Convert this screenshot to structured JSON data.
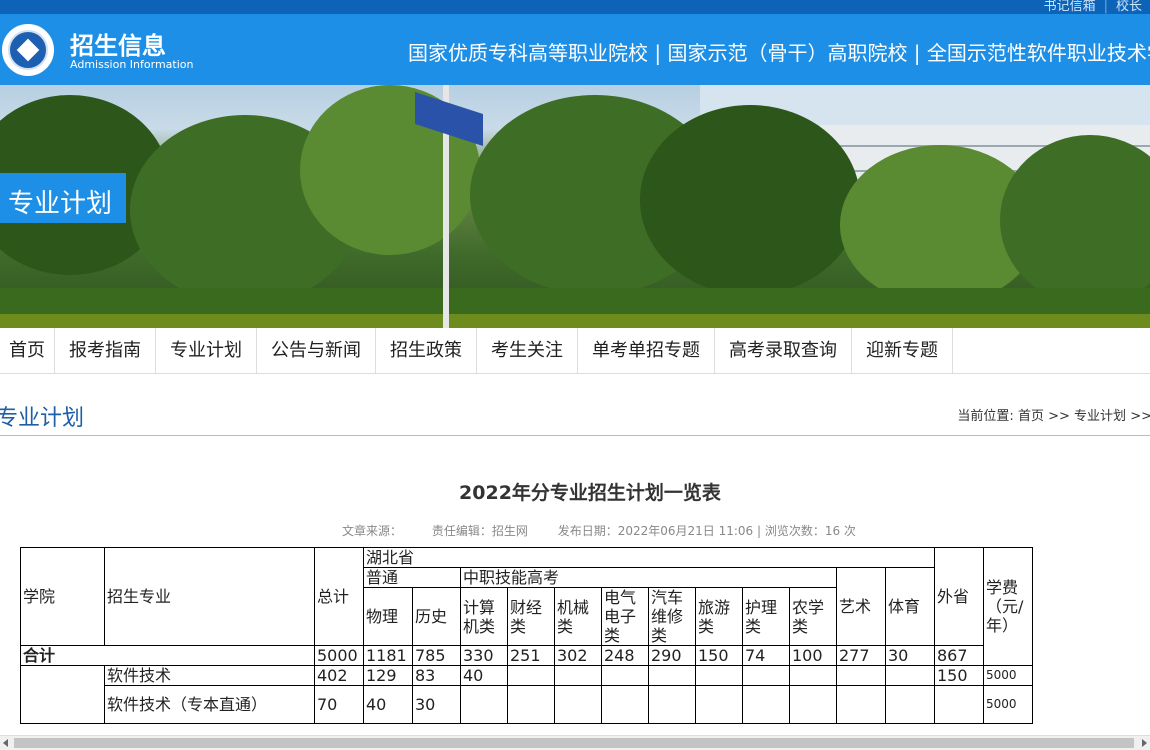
{
  "top_links": [
    "书记信箱",
    "校长"
  ],
  "header": {
    "title_cn": "招生信息",
    "title_en": "Admission Information",
    "slogan": "国家优质专科高等职业院校 | 国家示范（骨干）高职院校 | 全国示范性软件职业技术学"
  },
  "banner": {
    "label": "专业计划"
  },
  "nav": [
    "首页",
    "报考指南",
    "专业计划",
    "公告与新闻",
    "招生政策",
    "考生关注",
    "单考单招专题",
    "高考录取查询",
    "迎新专题"
  ],
  "page": {
    "title": "专业计划",
    "breadcrumb_prefix": "当前位置:",
    "breadcrumb": [
      "首页",
      "专业计划"
    ],
    "breadcrumb_sep": ">>"
  },
  "article": {
    "title": "2022年分专业招生计划一览表",
    "source": "文章来源：",
    "editor": "责任编辑：招生网",
    "published": "发布日期：2022年06月21日 11:06 | 浏览次数：16 次"
  },
  "table": {
    "h_college": "学院",
    "h_major": "招生专业",
    "h_total": "总计",
    "h_hubei": "湖北省",
    "h_putong": "普通",
    "h_zhongzhi": "中职技能高考",
    "h_art": "艺术",
    "h_pe": "体育",
    "h_outside": "外省",
    "h_fee": "学费（元/年）",
    "h_physics": "物理",
    "h_history": "历史",
    "h_computer": "计算机类",
    "h_finance": "财经类",
    "h_machine": "机械类",
    "h_electric": "电气电子类",
    "h_auto": "汽车维修类",
    "h_travel": "旅游类",
    "h_nursing": "护理类",
    "h_agri": "农学类",
    "total_row": {
      "label": "合计",
      "total": "5000",
      "physics": "1181",
      "history": "785",
      "computer": "330",
      "finance": "251",
      "machine": "302",
      "electric": "248",
      "auto": "290",
      "travel": "150",
      "nursing": "74",
      "agri": "100",
      "art": "277",
      "pe": "30",
      "outside": "867"
    },
    "rows": [
      {
        "major": "软件技术",
        "total": "402",
        "physics": "129",
        "history": "83",
        "computer": "40",
        "outside": "150",
        "fee": "5000"
      },
      {
        "major": "软件技术（专本直通）",
        "total": "70",
        "physics": "40",
        "history": "30",
        "fee": "5000"
      }
    ]
  }
}
